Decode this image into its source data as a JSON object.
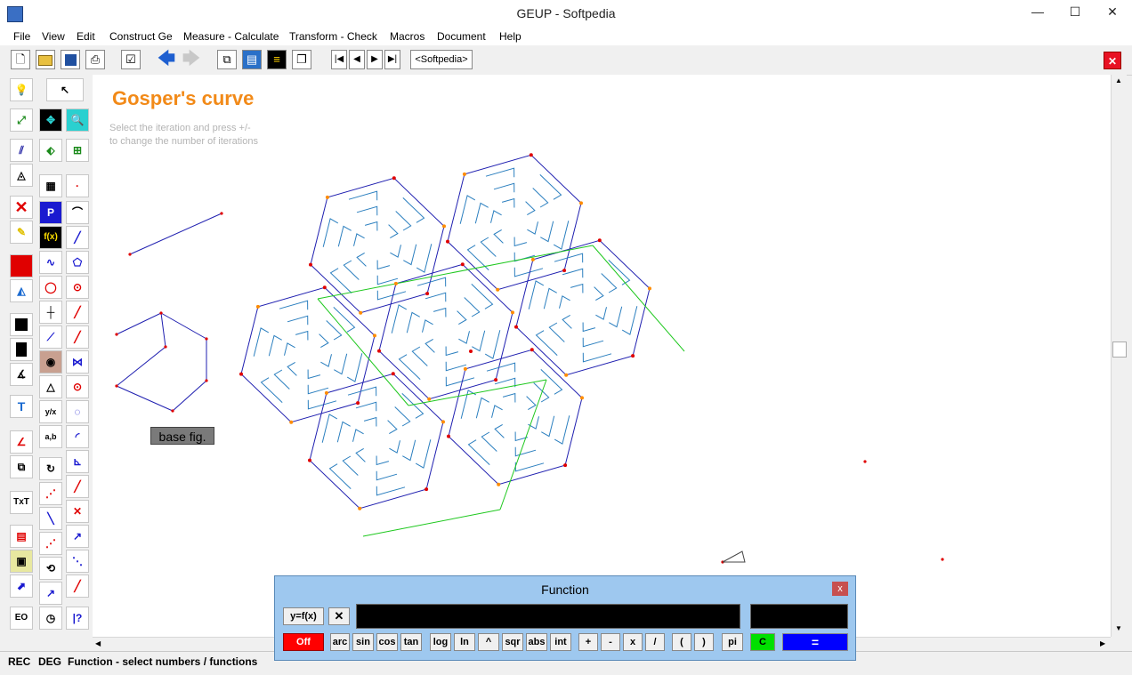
{
  "window": {
    "title": "GEUP - Softpedia",
    "minimize": "—",
    "maximize": "☐",
    "close": "✕"
  },
  "menu": [
    "File",
    "Edit",
    "Construct Ge",
    "Measure - Calculate",
    "Transform - Check",
    "Macros",
    "Document",
    "Help"
  ],
  "menu_view": "View",
  "toolbar": {
    "document_tab": "<Softpedia>",
    "close_doc": "✕",
    "icons": [
      "new-file-icon",
      "open-folder-icon",
      "save-icon",
      "print-icon",
      "checklist-icon",
      "back-arrow-icon",
      "forward-arrow-icon",
      "window-icon",
      "film-icon",
      "macro-icon",
      "layers-icon",
      "first-icon",
      "prev-icon",
      "next-icon",
      "last-icon"
    ]
  },
  "canvas": {
    "heading": "Gosper's curve",
    "hint_line1": "Select the iteration and press +/-",
    "hint_line2": "to change the number of iterations",
    "base_fig_label": "base fig."
  },
  "status": {
    "rec": "REC",
    "deg": "DEG",
    "message": "Function - select numbers / functions"
  },
  "function_dialog": {
    "title": "Function",
    "close": "x",
    "yfx": "y=f(x)",
    "clear": "✕",
    "off": "Off",
    "c_button": "C",
    "equals": "=",
    "keys": [
      "arc",
      "sin",
      "cos",
      "tan",
      "log",
      "ln",
      "^",
      "sqr",
      "abs",
      "int",
      "+",
      "-",
      "x",
      "/",
      "(",
      ")",
      "pi"
    ]
  },
  "colors": {
    "heading": "#f28a18",
    "curve": "#2b7fbf",
    "hex_outline": "#1f1fb0",
    "green_lines": "#1ec81e",
    "point_orange": "#ff8c00",
    "point_red": "#e00000",
    "dialog_bg": "#9ec8ef",
    "off_button": "#ff0000",
    "c_button": "#00e000",
    "equals_button": "#0000ff"
  }
}
